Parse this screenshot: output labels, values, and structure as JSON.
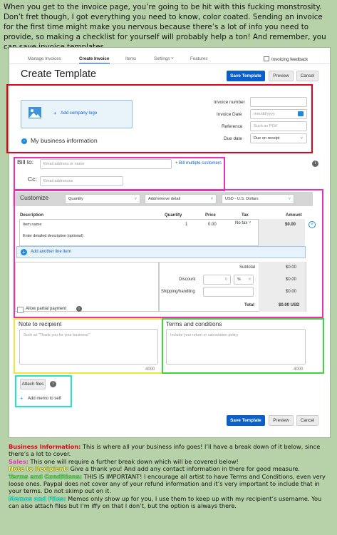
{
  "intro_text": "When you get to the invoice page, you’re going to be hit with this fucking monstrosity. Don’t fret though, I got everything you need to know, color coated. Sending an invoice for the first time might make you nervous because there’s a lot of info you need to provide, so making a checklist for yourself will probably help a ton! And remember, you can save invoice templates.",
  "nav": {
    "items": [
      "Manage Invoices",
      "Create Invoice",
      "Items",
      "Settings",
      "Features"
    ],
    "feedback": "Invoicing feedback"
  },
  "header": {
    "title": "Create Template",
    "save_template": "Save Template",
    "preview": "Preview",
    "cancel": "Cancel"
  },
  "business": {
    "add_logo": "Add company logo",
    "my_info": "My business information",
    "invoice_number_label": "Invoice number",
    "invoice_date_label": "Invoice Date",
    "invoice_date_placeholder": "mm/dd/yyyy",
    "reference_label": "Reference",
    "reference_placeholder": "Such as PO#",
    "due_date_label": "Due date",
    "due_date_value": "Due on receipt"
  },
  "billing": {
    "bill_to_label": "Bill to:",
    "bill_to_placeholder": "Email address or name",
    "multiple": "Bill multiple customers",
    "cc_label": "Cc:",
    "cc_placeholder": "Email addresses"
  },
  "customize": {
    "label": "Customize",
    "quantity": "Quantity",
    "detail": "Add/remove detail",
    "currency": "USD - U.S. Dollars"
  },
  "items_table": {
    "headers": [
      "Description",
      "Quantity",
      "Price",
      "Tax",
      "Amount"
    ],
    "item_placeholder": "Item name",
    "qty": "1",
    "price": "0.00",
    "tax": "No tax",
    "amount": "$0.00",
    "desc_placeholder": "Enter detailed description (optional)",
    "add_line": "Add another line item"
  },
  "totals": {
    "subtotal_label": "Subtotal",
    "subtotal": "$0.00",
    "discount_label": "Discount",
    "discount_value": "0",
    "discount_unit": "%",
    "discount_amount": "$0.00",
    "shipping_label": "Shipping/handling",
    "shipping_amount": "$0.00",
    "total_label": "Total",
    "total": "$0.00 USD",
    "partial": "Allow partial payment"
  },
  "note": {
    "title": "Note to recipient",
    "placeholder": "Such as \"Thank you for your business\"",
    "count": "4000"
  },
  "terms": {
    "title": "Terms and conditions",
    "placeholder": "Include your return or cancelation policy",
    "count": "4000"
  },
  "memo": {
    "attach": "Attach files",
    "add_memo": "Add memo to self"
  },
  "footer": {
    "save_template": "Save Template",
    "preview": "Preview",
    "cancel": "Cancel"
  },
  "legend": [
    {
      "key": "Business Information:",
      "text": "This is where all your business info goes! I’ll have a break down of it below, since there’s a lot to cover.",
      "color": "#e3001b"
    },
    {
      "key": "Sales:",
      "text": "This one will require a further break down which will be covered below!",
      "color": "#ec2fb8"
    },
    {
      "key": "Note to Recipient:",
      "text": "Give a thank you! And add any contact information in there for good measure.",
      "color": "#e9e834"
    },
    {
      "key": "Terms and Conditions:",
      "text": "THIS IS IMPORTANT! I encourage all artist to have Terms and Conditions, even very loose ones. Paypal does not cover any of your refund information and it’s very important to include that in your terms. Do not skimp out on it.",
      "color": "#3ed53b"
    },
    {
      "key": "Memos and Files:",
      "text": "Memos only show up for you, I use them to keep up with my recipient’s username. You can also attach files but I’m iffy on that I don’t, but the option is always there.",
      "color": "#21e6c5"
    }
  ]
}
